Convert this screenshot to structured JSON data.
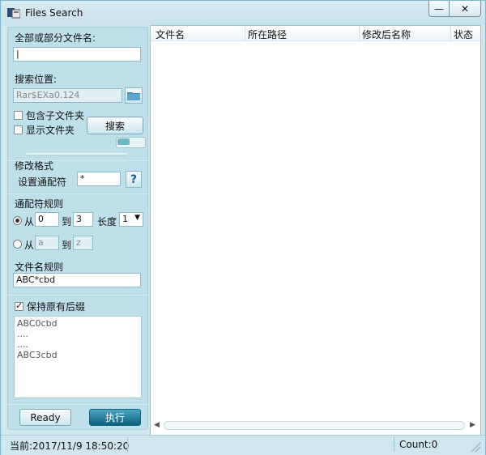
{
  "window": {
    "title": "Files Search",
    "minimize_glyph": "—",
    "close_glyph": "✕"
  },
  "search": {
    "name_label": "全部或部分文件名:",
    "name_value": "|",
    "location_label": "搜索位置:",
    "location_value": "Rar$EXa0.124",
    "folder_icon": "folder-icon",
    "include_subfolders": {
      "label": "包含子文件夹",
      "checked": false
    },
    "show_folders": {
      "label": "显示文件夹",
      "checked": false
    },
    "search_button": "搜索"
  },
  "modify": {
    "section_label": "修改格式",
    "wildcard_label": "设置通配符",
    "wildcard_value": "*",
    "help_glyph": "?",
    "rules_label": "通配符规则",
    "rule1": {
      "from_label": "从",
      "from_value": "0",
      "to_label": "到",
      "to_value": "3",
      "length_label": "长度",
      "length_value": "1",
      "selected": true
    },
    "rule2": {
      "from_label": "从",
      "from_value": "a",
      "to_label": "到",
      "to_value": "z",
      "selected": false
    },
    "filename_rule_label": "文件名规则",
    "filename_rule_value": "ABC*cbd",
    "keep_suffix": {
      "label": "保持原有后缀",
      "checked": true
    },
    "preview_lines": [
      "ABC0cbd",
      "....",
      "....",
      "ABC3cbd"
    ]
  },
  "actions": {
    "ready_button": "Ready",
    "execute_button": "执行"
  },
  "results": {
    "columns": [
      "文件名",
      "所在路径",
      "修改后名称",
      "状态"
    ]
  },
  "status": {
    "current": "当前:2017/11/9 18:50:20",
    "count": "Count:0"
  },
  "colors": {
    "background": "#cfe6ee",
    "accent": "#0d5f7f"
  }
}
